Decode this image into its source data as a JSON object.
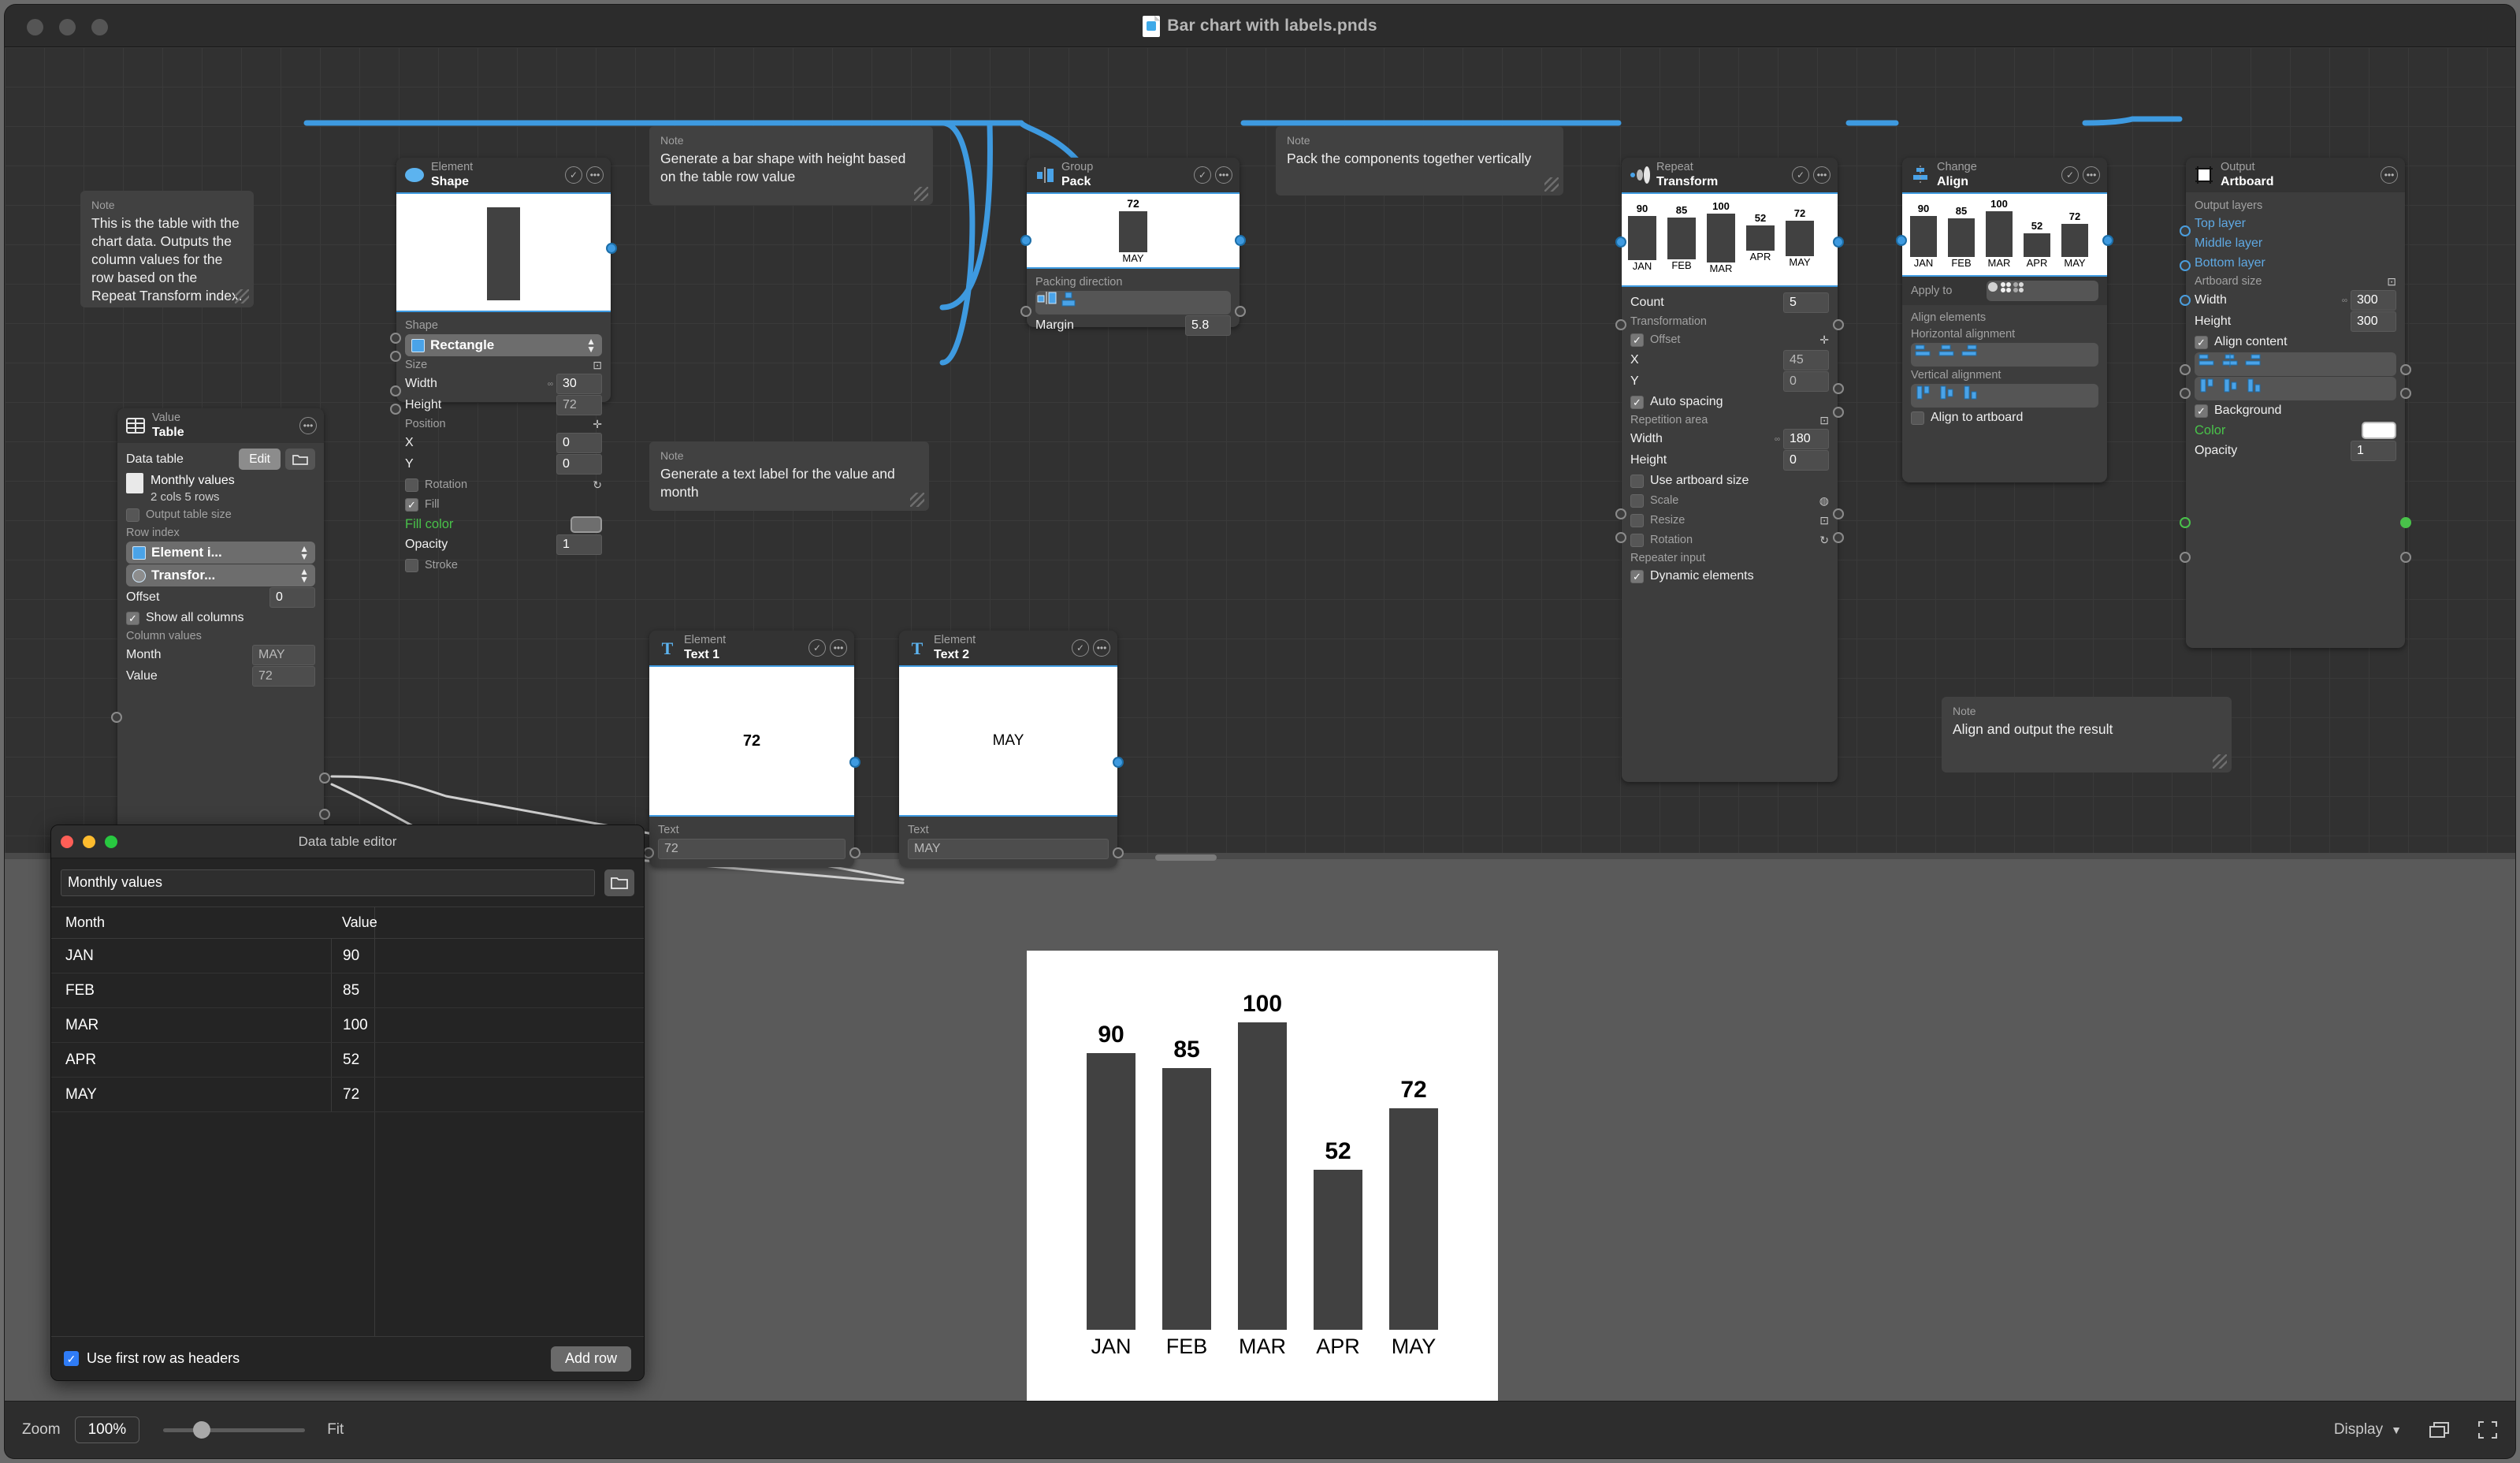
{
  "window": {
    "title": "Bar chart with labels.pnds",
    "doc_icon": "document-icon",
    "traffic_lights": [
      "close",
      "minimize",
      "zoom"
    ]
  },
  "notes": [
    {
      "label": "Note",
      "text": "This is the table with the chart data. Outputs the column values for the row based on the Repeat Transform index."
    },
    {
      "label": "Note",
      "text": "Generate a bar shape with height based on the table row value"
    },
    {
      "label": "Note",
      "text": "Pack the components together vertically"
    },
    {
      "label": "Note",
      "text": "Generate a text label for the value and month"
    },
    {
      "label": "Note",
      "text": "Align and output the result"
    }
  ],
  "nodes": {
    "table": {
      "category": "Value",
      "name": "Table",
      "icon": "table-icon",
      "menu_icon": "ellipsis-icon",
      "data_table_label": "Data table",
      "edit_button": "Edit",
      "folder_icon": "folder-icon",
      "file_name": "Monthly values",
      "file_meta": "2 cols 5 rows",
      "output_table_size": {
        "label": "Output table size",
        "checked": false
      },
      "row_index_label": "Row index",
      "row_index_source": "Element i...",
      "row_index_node": "Transfor...",
      "offset_label": "Offset",
      "offset_value": "0",
      "show_all_columns": {
        "label": "Show all columns",
        "checked": true
      },
      "column_values_label": "Column values",
      "columns": [
        {
          "name": "Month",
          "value": "MAY"
        },
        {
          "name": "Value",
          "value": "72"
        }
      ]
    },
    "shape": {
      "category": "Element",
      "name": "Shape",
      "icon": "ellipse-icon",
      "check_icon": "check-circle-icon",
      "menu_icon": "ellipsis-icon",
      "shape_label": "Shape",
      "shape_value": "Rectangle",
      "size_label": "Size",
      "width_label": "Width",
      "width_value": "30",
      "height_label": "Height",
      "height_value": "72",
      "position_label": "Position",
      "x_label": "X",
      "x_value": "0",
      "y_label": "Y",
      "y_value": "0",
      "rotation": {
        "label": "Rotation",
        "checked": false
      },
      "fill": {
        "label": "Fill",
        "checked": true
      },
      "fill_color_label": "Fill color",
      "opacity_label": "Opacity",
      "opacity_value": "1",
      "stroke": {
        "label": "Stroke",
        "checked": false
      }
    },
    "pack": {
      "category": "Group",
      "name": "Pack",
      "icon": "pack-icon",
      "check_icon": "check-circle-icon",
      "menu_icon": "ellipsis-icon",
      "preview_value": "72",
      "preview_label": "MAY",
      "packing_direction_label": "Packing direction",
      "direction_options": [
        "horizontal",
        "vertical"
      ],
      "direction_selected": 1,
      "margin_label": "Margin",
      "margin_value": "5.8"
    },
    "text1": {
      "category": "Element",
      "name": "Text 1",
      "icon": "text-t-icon",
      "check_icon": "check-circle-icon",
      "menu_icon": "ellipsis-icon",
      "preview_text": "72",
      "text_label": "Text",
      "text_value": "72"
    },
    "text2": {
      "category": "Element",
      "name": "Text 2",
      "icon": "text-t-icon",
      "check_icon": "check-circle-icon",
      "menu_icon": "ellipsis-icon",
      "preview_text": "MAY",
      "text_label": "Text",
      "text_value": "MAY"
    },
    "repeat": {
      "category": "Repeat",
      "name": "Transform",
      "icon": "repeat-transform-icon",
      "check_icon": "check-circle-icon",
      "menu_icon": "ellipsis-icon",
      "count_label": "Count",
      "count_value": "5",
      "transformation_label": "Transformation",
      "offset": {
        "label": "Offset",
        "checked": true
      },
      "x_label": "X",
      "x_value": "45",
      "y_label": "Y",
      "y_value": "0",
      "auto_spacing": {
        "label": "Auto spacing",
        "checked": true
      },
      "repetition_area_label": "Repetition area",
      "width_label": "Width",
      "width_value": "180",
      "height_label": "Height",
      "height_value": "0",
      "use_artboard_size": {
        "label": "Use artboard size",
        "checked": false
      },
      "scale": {
        "label": "Scale",
        "checked": false
      },
      "resize": {
        "label": "Resize",
        "checked": false
      },
      "rotation": {
        "label": "Rotation",
        "checked": false
      },
      "repeater_input_label": "Repeater input",
      "dynamic_elements": {
        "label": "Dynamic elements",
        "checked": true
      }
    },
    "align": {
      "category": "Change",
      "name": "Align",
      "icon": "align-icon",
      "check_icon": "check-circle-icon",
      "menu_icon": "ellipsis-icon",
      "apply_to_label": "Apply to",
      "apply_to_options": [
        "single",
        "group",
        "elements"
      ],
      "apply_to_selected": 1,
      "align_elements_label": "Align elements",
      "horizontal_label": "Horizontal alignment",
      "horizontal_options": [
        "left",
        "center",
        "right"
      ],
      "horizontal_selected": -1,
      "vertical_label": "Vertical alignment",
      "vertical_options": [
        "top",
        "middle",
        "bottom"
      ],
      "vertical_selected": 2,
      "align_to_artboard": {
        "label": "Align to artboard",
        "checked": false
      }
    },
    "artboard": {
      "category": "Output",
      "name": "Artboard",
      "icon": "artboard-icon",
      "menu_icon": "ellipsis-icon",
      "output_layers_label": "Output layers",
      "layers": [
        "Top layer",
        "Middle layer",
        "Bottom layer"
      ],
      "artboard_size_label": "Artboard size",
      "width_label": "Width",
      "width_value": "300",
      "height_label": "Height",
      "height_value": "300",
      "align_content": {
        "label": "Align content",
        "checked": true
      },
      "h_align_selected": 1,
      "v_align_selected": 1,
      "background": {
        "label": "Background",
        "checked": true
      },
      "color_label": "Color",
      "color_value": "#ffffff",
      "opacity_label": "Opacity",
      "opacity_value": "1"
    }
  },
  "data_table_editor": {
    "title": "Data table editor",
    "name_value": "Monthly values",
    "folder_icon": "folder-icon",
    "headers": [
      "Month",
      "Value"
    ],
    "rows": [
      [
        "JAN",
        "90"
      ],
      [
        "FEB",
        "85"
      ],
      [
        "MAR",
        "100"
      ],
      [
        "APR",
        "52"
      ],
      [
        "MAY",
        "72"
      ]
    ],
    "use_first_row_as_headers": {
      "label": "Use first row as headers",
      "checked": true
    },
    "add_row_button": "Add row"
  },
  "statusbar": {
    "zoom_label": "Zoom",
    "zoom_value": "100%",
    "fit_label": "Fit",
    "display_label": "Display",
    "chevron_icon": "chevron-down-icon",
    "layers_icon": "layers-icon",
    "fullscreen_icon": "fullscreen-icon"
  },
  "chart_data": {
    "type": "bar",
    "categories": [
      "JAN",
      "FEB",
      "MAR",
      "APR",
      "MAY"
    ],
    "values": [
      90,
      85,
      100,
      52,
      72
    ],
    "title": "",
    "xlabel": "",
    "ylabel": "",
    "ylim": [
      0,
      100
    ],
    "bar_color": "#414141",
    "background": "#ffffff",
    "data_labels": true,
    "grid": false,
    "legend": false
  }
}
